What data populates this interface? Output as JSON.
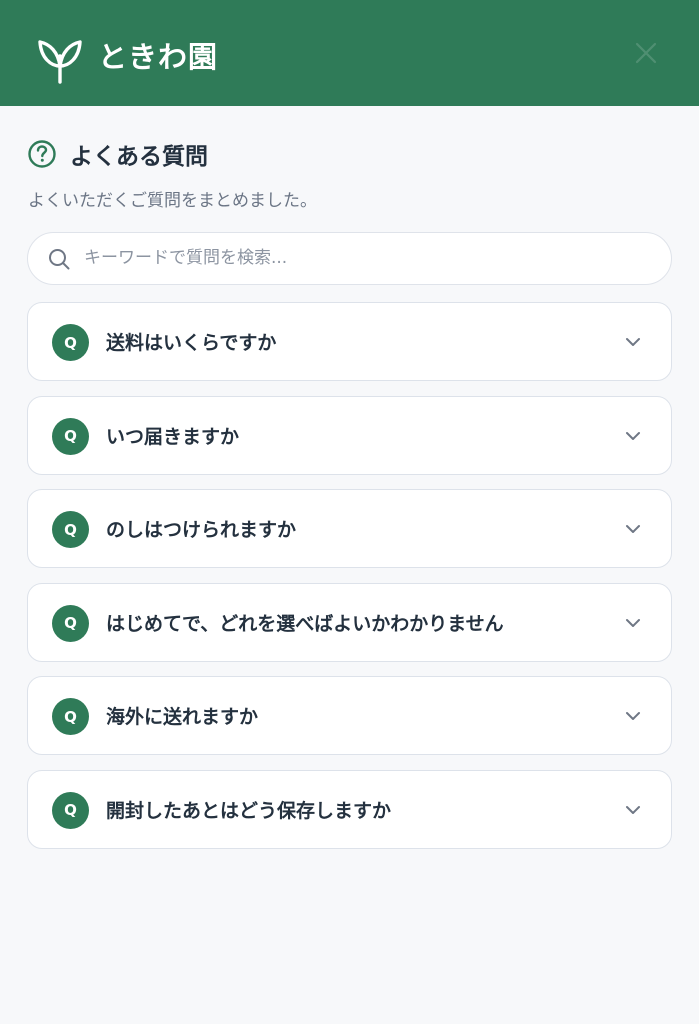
{
  "header": {
    "brand": "ときわ園",
    "logo_icon": "sprout-icon",
    "close_icon": "close-icon",
    "background": "#2f7b58"
  },
  "faq": {
    "title": "よくある質問",
    "title_icon": "help-circle-icon",
    "subtitle": "よくいただくご質問をまとめました。",
    "search_placeholder": "キーワードで質問を検索...",
    "search_icon": "search-icon",
    "badge": "Q",
    "accent": "#2f7b58",
    "items": [
      {
        "question": "送料はいくらですか"
      },
      {
        "question": "いつ届きますか"
      },
      {
        "question": "のしはつけられますか"
      },
      {
        "question": "はじめてで、どれを選べばよいかわかりません"
      },
      {
        "question": "海外に送れますか"
      },
      {
        "question": "開封したあとはどう保存しますか"
      }
    ]
  }
}
